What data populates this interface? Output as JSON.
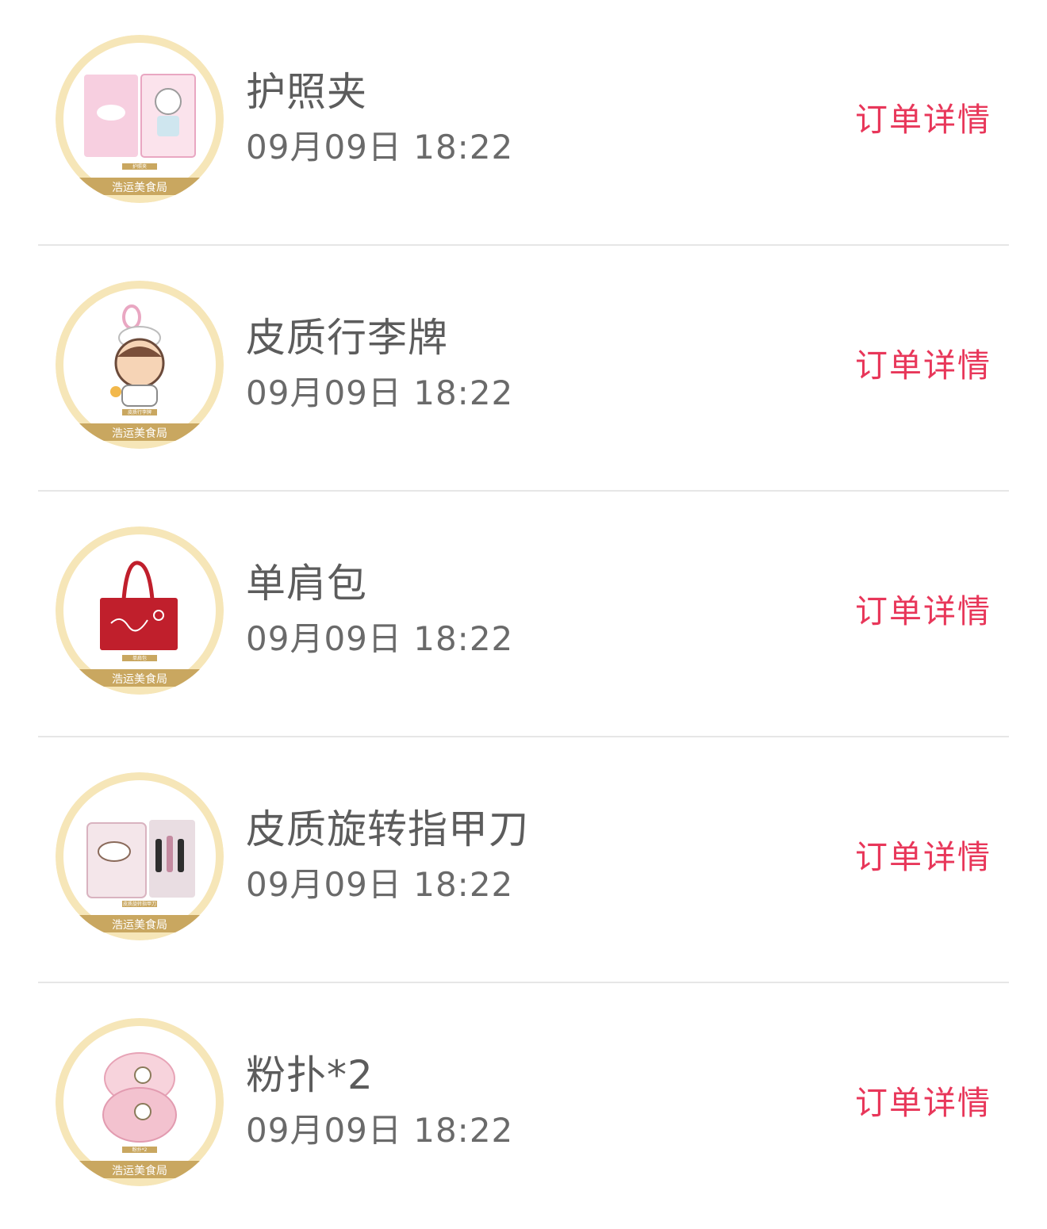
{
  "orders": [
    {
      "name": "护照夹",
      "time": "09月09日 18:22",
      "action": "订单详情",
      "thumb_caption": "浩运美食局",
      "thumb_tag": "护照夹",
      "thumb_icon": "passport-holder-icon"
    },
    {
      "name": "皮质行李牌",
      "time": "09月09日 18:22",
      "action": "订单详情",
      "thumb_caption": "浩运美食局",
      "thumb_tag": "皮质行李牌",
      "thumb_icon": "luggage-tag-icon"
    },
    {
      "name": "单肩包",
      "time": "09月09日 18:22",
      "action": "订单详情",
      "thumb_caption": "浩运美食局",
      "thumb_tag": "单肩包",
      "thumb_icon": "tote-bag-icon"
    },
    {
      "name": "皮质旋转指甲刀",
      "time": "09月09日 18:22",
      "action": "订单详情",
      "thumb_caption": "浩运美食局",
      "thumb_tag": "皮质旋转指甲刀",
      "thumb_icon": "nail-clipper-icon"
    },
    {
      "name": "粉扑*2",
      "time": "09月09日 18:22",
      "action": "订单详情",
      "thumb_caption": "浩运美食局",
      "thumb_tag": "粉扑*2",
      "thumb_icon": "powder-puff-icon"
    }
  ],
  "colors": {
    "action": "#e8375a",
    "name": "#5c5c5c",
    "time": "#6a6a6a",
    "separator": "#e6e6e6",
    "thumb_ring": "#f3dfa8",
    "thumb_banner": "#c9a760"
  }
}
